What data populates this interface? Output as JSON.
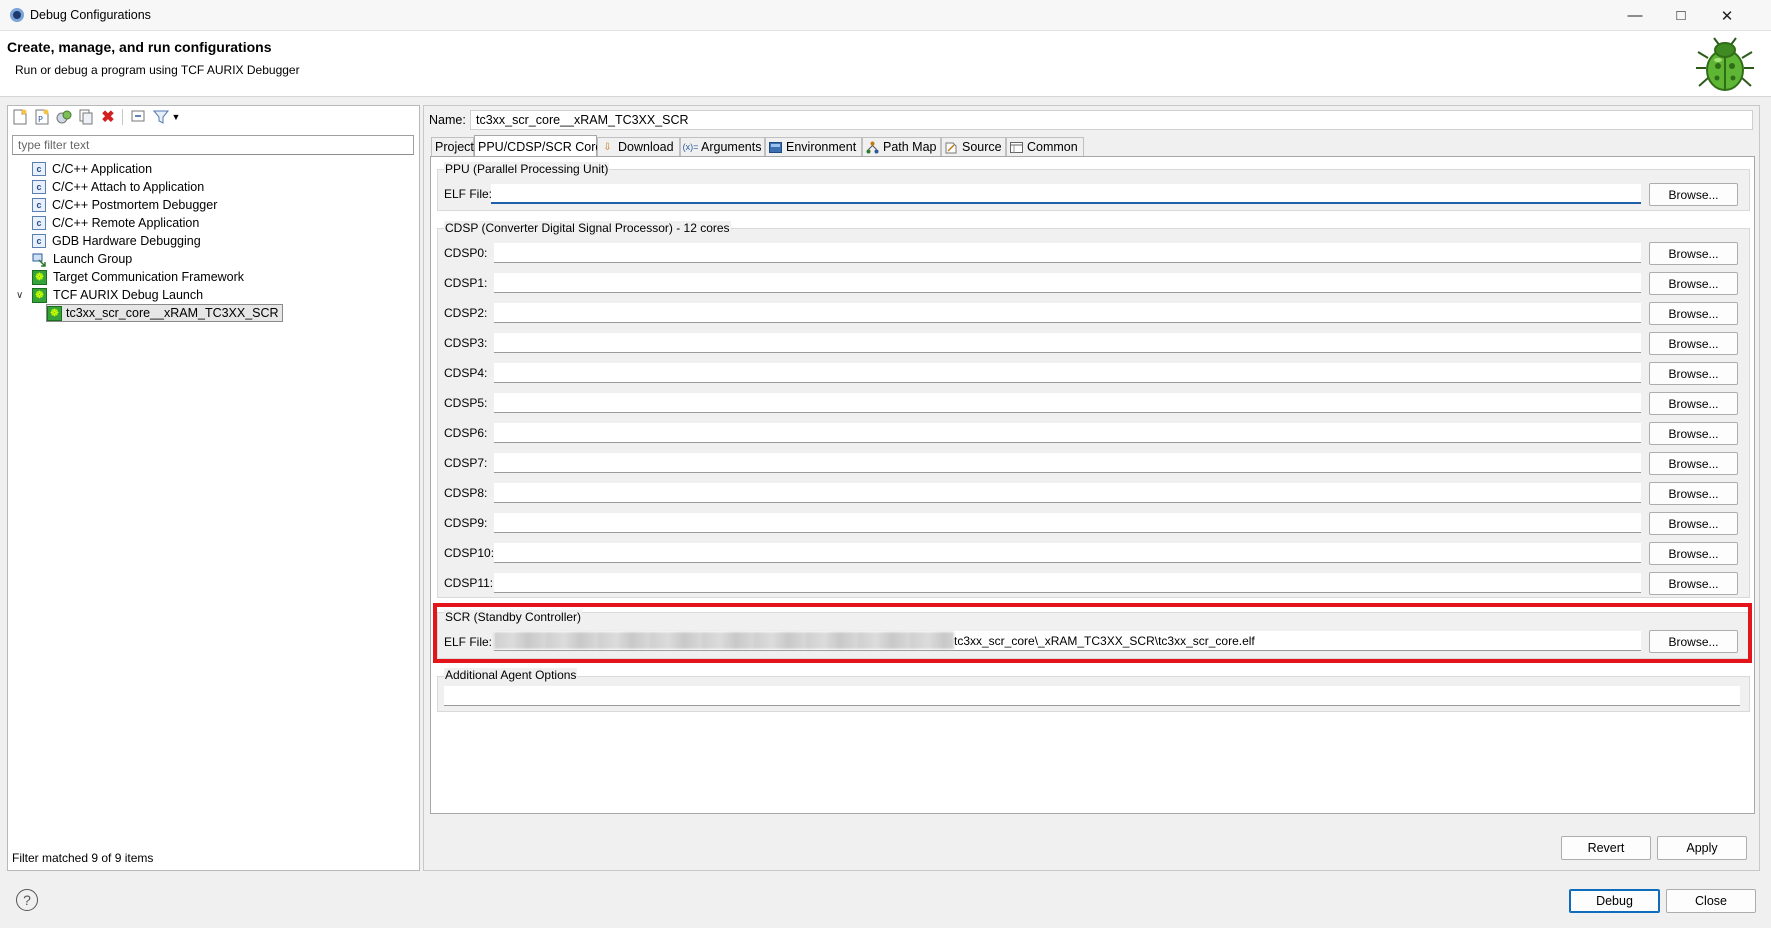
{
  "window": {
    "title": "Debug Configurations",
    "minimize_icon": "minimize-icon",
    "maximize_icon": "maximize-icon",
    "close_icon": "close-icon"
  },
  "header": {
    "title": "Create, manage, and run configurations",
    "subtitle": "Run or debug a program using TCF AURIX Debugger",
    "icon": "bug-icon"
  },
  "left_panel": {
    "toolbar_icons": [
      "new-config-icon",
      "new-prototype-icon",
      "export-icon",
      "duplicate-icon",
      "delete-icon",
      "collapse-all-icon",
      "filter-icon",
      "dropdown-arrow-icon"
    ],
    "filter_placeholder": "type filter text",
    "tree": [
      {
        "label": "C/C++ Application",
        "icon": "c-app-icon"
      },
      {
        "label": "C/C++ Attach to Application",
        "icon": "c-app-icon"
      },
      {
        "label": "C/C++ Postmortem Debugger",
        "icon": "c-app-icon"
      },
      {
        "label": "C/C++ Remote Application",
        "icon": "c-app-icon"
      },
      {
        "label": "GDB Hardware Debugging",
        "icon": "c-app-icon"
      },
      {
        "label": "Launch Group",
        "icon": "launch-group-icon"
      },
      {
        "label": "Target Communication Framework",
        "icon": "tcf-icon"
      },
      {
        "label": "TCF AURIX Debug Launch",
        "icon": "tcf-icon",
        "expanded": true
      },
      {
        "label": "tc3xx_scr_core__xRAM_TC3XX_SCR",
        "icon": "tcf-icon",
        "selected": true
      }
    ],
    "status": "Filter matched 9 of 9 items"
  },
  "right_panel": {
    "name_label": "Name:",
    "name_value": "tc3xx_scr_core__xRAM_TC3XX_SCR",
    "tabs": [
      {
        "label": "Project"
      },
      {
        "label": "PPU/CDSP/SCR Cores",
        "active": true
      },
      {
        "label": "Download",
        "icon": "download-icon"
      },
      {
        "label": "Arguments",
        "icon": "arguments-icon"
      },
      {
        "label": "Environment",
        "icon": "environment-icon"
      },
      {
        "label": "Path Map",
        "icon": "path-map-icon"
      },
      {
        "label": "Source",
        "icon": "source-icon"
      },
      {
        "label": "Common",
        "icon": "common-icon"
      }
    ],
    "ppu": {
      "group_label": "PPU (Parallel Processing Unit)",
      "elf_label": "ELF File:",
      "elf_value": "",
      "browse": "Browse..."
    },
    "cdsp": {
      "group_label": "CDSP (Converter Digital Signal Processor) - 12 cores",
      "rows": [
        {
          "label": "CDSP0:",
          "value": ""
        },
        {
          "label": "CDSP1:",
          "value": ""
        },
        {
          "label": "CDSP2:",
          "value": ""
        },
        {
          "label": "CDSP3:",
          "value": ""
        },
        {
          "label": "CDSP4:",
          "value": ""
        },
        {
          "label": "CDSP5:",
          "value": ""
        },
        {
          "label": "CDSP6:",
          "value": ""
        },
        {
          "label": "CDSP7:",
          "value": ""
        },
        {
          "label": "CDSP8:",
          "value": ""
        },
        {
          "label": "CDSP9:",
          "value": ""
        },
        {
          "label": "CDSP10:",
          "value": ""
        },
        {
          "label": "CDSP11:",
          "value": ""
        }
      ],
      "browse": "Browse..."
    },
    "scr": {
      "group_label": "SCR (Standby Controller)",
      "elf_label": "ELF File:",
      "elf_value_visible": "tc3xx_scr_core\\_xRAM_TC3XX_SCR\\tc3xx_scr_core.elf",
      "browse": "Browse...",
      "highlight_color": "#e3151a"
    },
    "additional": {
      "group_label": "Additional Agent Options",
      "value": ""
    },
    "revert": "Revert",
    "apply": "Apply"
  },
  "footer": {
    "help_icon": "help-icon",
    "debug": "Debug",
    "close": "Close"
  }
}
